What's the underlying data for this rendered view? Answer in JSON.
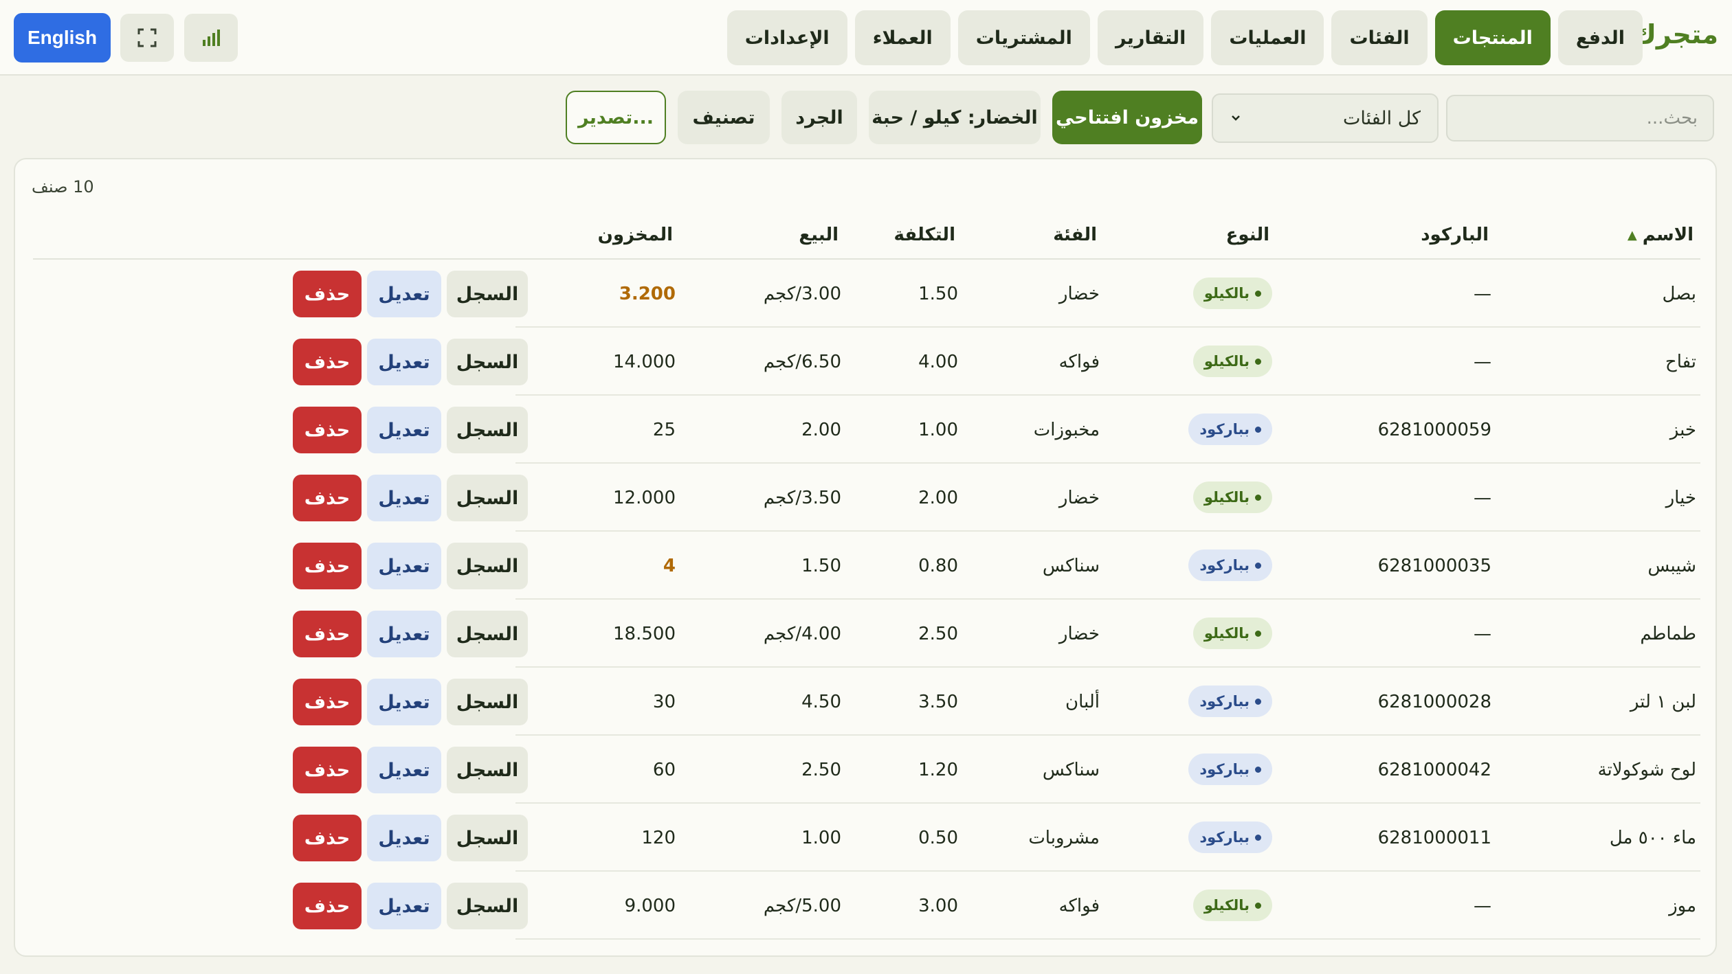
{
  "brand": "متجرك",
  "nav": {
    "items": [
      {
        "label": "الدفع",
        "active": false
      },
      {
        "label": "المنتجات",
        "active": true
      },
      {
        "label": "الفئات",
        "active": false
      },
      {
        "label": "العمليات",
        "active": false
      },
      {
        "label": "التقارير",
        "active": false
      },
      {
        "label": "المشتريات",
        "active": false
      },
      {
        "label": "العملاء",
        "active": false
      },
      {
        "label": "الإعدادات",
        "active": false
      }
    ],
    "language_label": "English"
  },
  "toolbar": {
    "search_placeholder": "بحث...",
    "category_selected": "كل الفئات",
    "opening_stock_label": "مخزون افتتاحي",
    "veg_mode_label": "الخضار: كيلو / حبة",
    "inventory_label": "الجرد",
    "classify_label": "تصنيف",
    "export_label": "تصدير..."
  },
  "table": {
    "count_label": "10 صنف",
    "sort_indicator": "▲",
    "headers": {
      "name": "الاسم",
      "barcode": "الباركود",
      "type": "النوع",
      "category": "الفئة",
      "cost": "التكلفة",
      "price": "البيع",
      "stock": "المخزون"
    },
    "action_labels": {
      "log": "السجل",
      "edit": "تعديل",
      "delete": "حذف"
    },
    "rows": [
      {
        "name": "بصل",
        "barcode": "—",
        "type": "بالكيلو",
        "category": "خضار",
        "cost": "1.50",
        "price": "3.00/كجم",
        "stock": "3.200",
        "low": true
      },
      {
        "name": "تفاح",
        "barcode": "—",
        "type": "بالكيلو",
        "category": "فواكه",
        "cost": "4.00",
        "price": "6.50/كجم",
        "stock": "14.000",
        "low": false
      },
      {
        "name": "خبز",
        "barcode": "6281000059",
        "type": "بباركود",
        "category": "مخبوزات",
        "cost": "1.00",
        "price": "2.00",
        "stock": "25",
        "low": false
      },
      {
        "name": "خيار",
        "barcode": "—",
        "type": "بالكيلو",
        "category": "خضار",
        "cost": "2.00",
        "price": "3.50/كجم",
        "stock": "12.000",
        "low": false
      },
      {
        "name": "شيبس",
        "barcode": "6281000035",
        "type": "بباركود",
        "category": "سناكس",
        "cost": "0.80",
        "price": "1.50",
        "stock": "4",
        "low": true
      },
      {
        "name": "طماطم",
        "barcode": "—",
        "type": "بالكيلو",
        "category": "خضار",
        "cost": "2.50",
        "price": "4.00/كجم",
        "stock": "18.500",
        "low": false
      },
      {
        "name": "لبن ١ لتر",
        "barcode": "6281000028",
        "type": "بباركود",
        "category": "ألبان",
        "cost": "3.50",
        "price": "4.50",
        "stock": "30",
        "low": false
      },
      {
        "name": "لوح شوكولاتة",
        "barcode": "6281000042",
        "type": "بباركود",
        "category": "سناكس",
        "cost": "1.20",
        "price": "2.50",
        "stock": "60",
        "low": false
      },
      {
        "name": "ماء ٥٠٠ مل",
        "barcode": "6281000011",
        "type": "بباركود",
        "category": "مشروبات",
        "cost": "0.50",
        "price": "1.00",
        "stock": "120",
        "low": false
      },
      {
        "name": "موز",
        "barcode": "—",
        "type": "بالكيلو",
        "category": "فواكه",
        "cost": "3.00",
        "price": "5.00/كجم",
        "stock": "9.000",
        "low": false
      }
    ]
  },
  "colors": {
    "accent": "#4f7f22",
    "danger": "#c83232",
    "info": "#2f6de3",
    "warning": "#b06a06"
  },
  "icons": {
    "stats": "bar-chart-icon",
    "fullscreen": "fullscreen-icon",
    "dropdown": "chevron-down-icon",
    "sort": "sort-asc-icon"
  }
}
